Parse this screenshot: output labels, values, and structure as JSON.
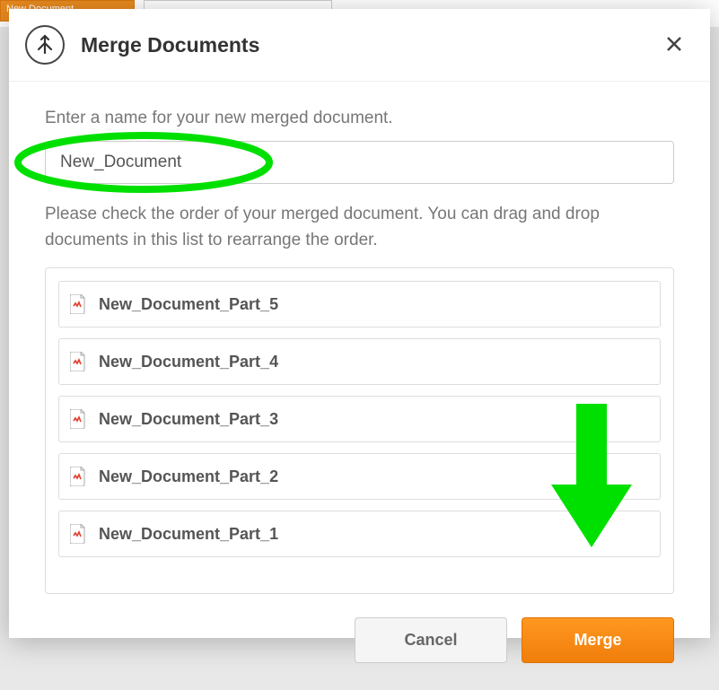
{
  "header": {
    "title": "Merge Documents",
    "new_doc_btn": "New Document"
  },
  "body": {
    "name_prompt": "Enter a name for your new merged document.",
    "name_value": "New_Document",
    "order_prompt": "Please check the order of your merged document. You can drag and drop documents in this list to rearrange the order.",
    "items": [
      {
        "name": "New_Document_Part_5"
      },
      {
        "name": "New_Document_Part_4"
      },
      {
        "name": "New_Document_Part_3"
      },
      {
        "name": "New_Document_Part_2"
      },
      {
        "name": "New_Document_Part_1"
      }
    ]
  },
  "footer": {
    "cancel": "Cancel",
    "merge": "Merge"
  },
  "annotation": {
    "color": "#00e000"
  }
}
